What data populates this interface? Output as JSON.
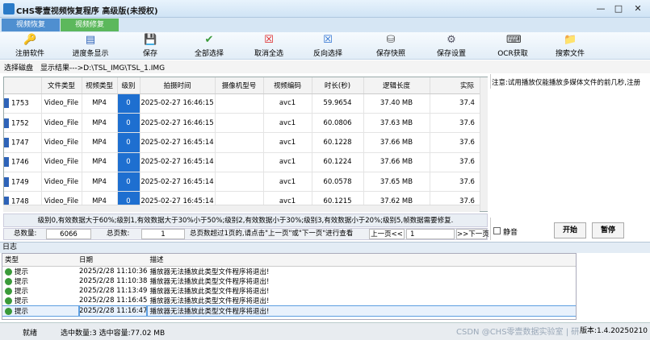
{
  "titlebar": {
    "title": "CHS零壹视频恢复程序 高级版(未授权)",
    "min": "—",
    "max": "□",
    "close": "✕"
  },
  "tabs": [
    "视频恢复",
    "视频修复"
  ],
  "toolbar": [
    {
      "label": "注册软件",
      "icon": "key-icon",
      "glyph": "🔑"
    },
    {
      "label": "进度条显示",
      "icon": "progress-icon",
      "glyph": "▤"
    },
    {
      "label": "保存",
      "icon": "save-icon",
      "glyph": "💾"
    },
    {
      "label": "全部选择",
      "icon": "check-icon",
      "glyph": "✔"
    },
    {
      "label": "取消全选",
      "icon": "uncheck-icon",
      "glyph": "☒"
    },
    {
      "label": "反向选择",
      "icon": "invert-icon",
      "glyph": "☒"
    },
    {
      "label": "保存快照",
      "icon": "snapshot-icon",
      "glyph": "⛁"
    },
    {
      "label": "保存设置",
      "icon": "settings-icon",
      "glyph": "⚙"
    },
    {
      "label": "OCR获取",
      "icon": "ocr-icon",
      "glyph": "⌨"
    },
    {
      "label": "搜索文件",
      "icon": "search-file-icon",
      "glyph": "📁"
    }
  ],
  "pathbar": {
    "label": "选择磁盘",
    "result": "显示结果--->D:\\TSL_IMG\\TSL_1.IMG"
  },
  "table": {
    "headers": [
      "",
      "文件类型",
      "视频类型",
      "级别",
      "拍摄时间",
      "摄像机型号",
      "视频编码",
      "时长(秒)",
      "逻辑长度",
      "实际"
    ],
    "rows": [
      [
        "1753",
        "Video_File",
        "MP4",
        "0",
        "2025-02-27 16:46:15",
        "",
        "avc1",
        "59.9654",
        "37.40 MB",
        "37.4"
      ],
      [
        "1752",
        "Video_File",
        "MP4",
        "0",
        "2025-02-27 16:46:15",
        "",
        "avc1",
        "60.0806",
        "37.63 MB",
        "37.6"
      ],
      [
        "1747",
        "Video_File",
        "MP4",
        "0",
        "2025-02-27 16:45:14",
        "",
        "avc1",
        "60.1228",
        "37.66 MB",
        "37.6"
      ],
      [
        "1746",
        "Video_File",
        "MP4",
        "0",
        "2025-02-27 16:45:14",
        "",
        "avc1",
        "60.1224",
        "37.66 MB",
        "37.6"
      ],
      [
        "1749",
        "Video_File",
        "MP4",
        "0",
        "2025-02-27 16:45:14",
        "",
        "avc1",
        "60.0578",
        "37.65 MB",
        "37.6"
      ],
      [
        "1748",
        "Video_File",
        "MP4",
        "0",
        "2025-02-27 16:45:14",
        "",
        "avc1",
        "60.1215",
        "37.62 MB",
        "37.6"
      ]
    ]
  },
  "legend": "级别0,有效数据大于60%;级别1,有效数据大于30%小于50%;级别2,有效数据小于30%;级别3,有效数据小于20%;级别5,帧数据需要修复.",
  "pager": {
    "total_label": "总数量:",
    "total_value": "6066",
    "pages_label": "总页数:",
    "pages_value": "1",
    "hint": "总页数超过1页的,请点击\"上一页\"或\"下一页\"进行查看",
    "prev": "上一页<<",
    "current": "1",
    "next": ">>下一页"
  },
  "right": {
    "notice": "注意:试用播放仅能播放多媒体文件的前几秒,注册",
    "mute": "静音",
    "start": "开始",
    "pause": "暂停"
  },
  "log": {
    "title": "日志",
    "headers": [
      "类型",
      "日期",
      "描述"
    ],
    "rows": [
      [
        "提示",
        "2025/2/28 11:10:36",
        "播放器无法播放此类型文件程序将退出!"
      ],
      [
        "提示",
        "2025/2/28 11:10:38",
        "播放器无法播放此类型文件程序将退出!"
      ],
      [
        "提示",
        "2025/2/28 11:13:49",
        "播放器无法播放此类型文件程序将退出!"
      ],
      [
        "提示",
        "2025/2/28 11:16:45",
        "播放器无法播放此类型文件程序将退出!"
      ],
      [
        "提示",
        "2025/2/28 11:16:47",
        "播放器无法播放此类型文件程序将退出!"
      ]
    ]
  },
  "status": {
    "ready": "就绪",
    "selection": "选中数量:3 选中容量:77.02 MB",
    "version": "版本:1.4.20250210",
    "watermark": "CSDN @CHS零壹数据实验室 | 研"
  },
  "colors": {
    "tab_recover": "#4f8fd0",
    "tab_repair": "#5cb85c",
    "level_cell": "#1e6fd0"
  }
}
